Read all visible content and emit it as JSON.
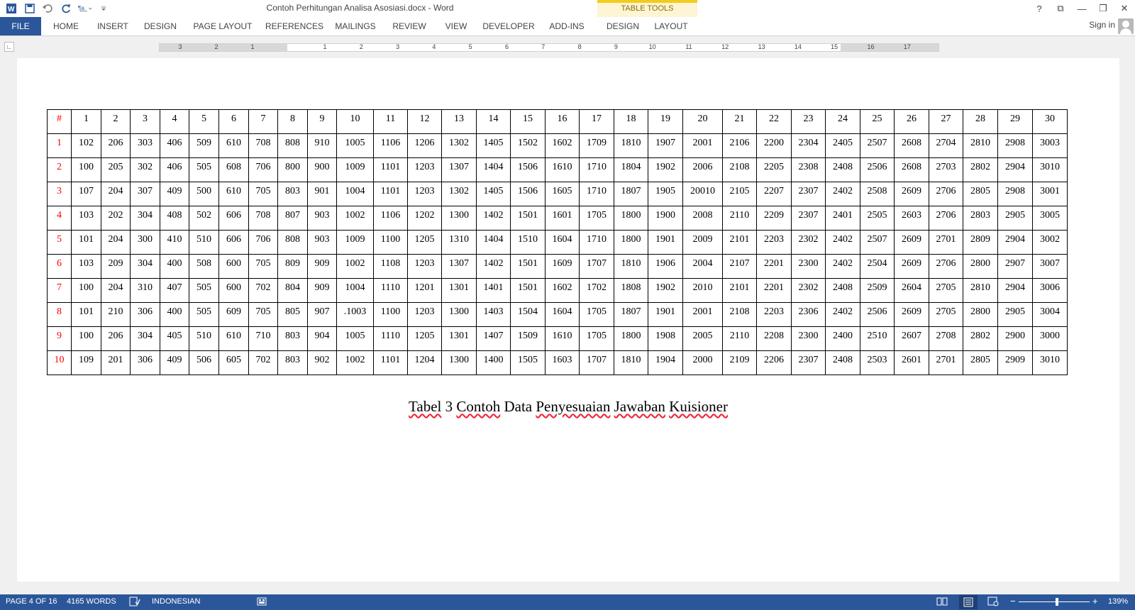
{
  "title_bar": {
    "document_title": "Contoh Perhitungan Analisa Asosiasi.docx - Word",
    "context_group": "TABLE TOOLS",
    "icons": [
      "word-app-icon",
      "save-icon",
      "undo-icon",
      "redo-icon",
      "format-icon",
      "customize-qat-icon"
    ],
    "window_buttons": [
      "?",
      "⧉",
      "—",
      "❐",
      "✕"
    ]
  },
  "ribbon": {
    "file_tab": "FILE",
    "tabs": [
      "HOME",
      "INSERT",
      "DESIGN",
      "PAGE LAYOUT",
      "REFERENCES",
      "MAILINGS",
      "REVIEW",
      "VIEW",
      "DEVELOPER",
      "ADD-INS"
    ],
    "context_tabs": [
      "DESIGN",
      "LAYOUT"
    ],
    "sign_in": "Sign in"
  },
  "ruler": {
    "left_numbers": [
      "3",
      "2",
      "1"
    ],
    "right_numbers": [
      "1",
      "2",
      "3",
      "4",
      "5",
      "6",
      "7",
      "8",
      "9",
      "10",
      "11",
      "12",
      "13",
      "14",
      "15",
      "16",
      "17"
    ]
  },
  "table": {
    "header": [
      "#",
      "1",
      "2",
      "3",
      "4",
      "5",
      "6",
      "7",
      "8",
      "9",
      "10",
      "11",
      "12",
      "13",
      "14",
      "15",
      "16",
      "17",
      "18",
      "19",
      "20",
      "21",
      "22",
      "23",
      "24",
      "25",
      "26",
      "27",
      "28",
      "29",
      "30"
    ],
    "rows": [
      [
        "1",
        "102",
        "206",
        "303",
        "406",
        "509",
        "610",
        "708",
        "808",
        "910",
        "1005",
        "1106",
        "1206",
        "1302",
        "1405",
        "1502",
        "1602",
        "1709",
        "1810",
        "1907",
        "2001",
        "2106",
        "2200",
        "2304",
        "2405",
        "2507",
        "2608",
        "2704",
        "2810",
        "2908",
        "3003"
      ],
      [
        "2",
        "100",
        "205",
        "302",
        "406",
        "505",
        "608",
        "706",
        "800",
        "900",
        "1009",
        "1101",
        "1203",
        "1307",
        "1404",
        "1506",
        "1610",
        "1710",
        "1804",
        "1902",
        "2006",
        "2108",
        "2205",
        "2308",
        "2408",
        "2506",
        "2608",
        "2703",
        "2802",
        "2904",
        "3010"
      ],
      [
        "3",
        "107",
        "204",
        "307",
        "409",
        "500",
        "610",
        "705",
        "803",
        "901",
        "1004",
        "1101",
        "1203",
        "1302",
        "1405",
        "1506",
        "1605",
        "1710",
        "1807",
        "1905",
        "20010",
        "2105",
        "2207",
        "2307",
        "2402",
        "2508",
        "2609",
        "2706",
        "2805",
        "2908",
        "3001"
      ],
      [
        "4",
        "103",
        "202",
        "304",
        "408",
        "502",
        "606",
        "708",
        "807",
        "903",
        "1002",
        "1106",
        "1202",
        "1300",
        "1402",
        "1501",
        "1601",
        "1705",
        "1800",
        "1900",
        "2008",
        "2110",
        "2209",
        "2307",
        "2401",
        "2505",
        "2603",
        "2706",
        "2803",
        "2905",
        "3005"
      ],
      [
        "5",
        "101",
        "204",
        "300",
        "410",
        "510",
        "606",
        "706",
        "808",
        "903",
        "1009",
        "1100",
        "1205",
        "1310",
        "1404",
        "1510",
        "1604",
        "1710",
        "1800",
        "1901",
        "2009",
        "2101",
        "2203",
        "2302",
        "2402",
        "2507",
        "2609",
        "2701",
        "2809",
        "2904",
        "3002"
      ],
      [
        "6",
        "103",
        "209",
        "304",
        "400",
        "508",
        "600",
        "705",
        "809",
        "909",
        "1002",
        "1108",
        "1203",
        "1307",
        "1402",
        "1501",
        "1609",
        "1707",
        "1810",
        "1906",
        "2004",
        "2107",
        "2201",
        "2300",
        "2402",
        "2504",
        "2609",
        "2706",
        "2800",
        "2907",
        "3007"
      ],
      [
        "7",
        "100",
        "204",
        "310",
        "407",
        "505",
        "600",
        "702",
        "804",
        "909",
        "1004",
        "1110",
        "1201",
        "1301",
        "1401",
        "1501",
        "1602",
        "1702",
        "1808",
        "1902",
        "2010",
        "2101",
        "2201",
        "2302",
        "2408",
        "2509",
        "2604",
        "2705",
        "2810",
        "2904",
        "3006"
      ],
      [
        "8",
        "101",
        "210",
        "306",
        "400",
        "505",
        "609",
        "705",
        "805",
        "907",
        ".1003",
        "1100",
        "1203",
        "1300",
        "1403",
        "1504",
        "1604",
        "1705",
        "1807",
        "1901",
        "2001",
        "2108",
        "2203",
        "2306",
        "2402",
        "2506",
        "2609",
        "2705",
        "2800",
        "2905",
        "3004"
      ],
      [
        "9",
        "100",
        "206",
        "304",
        "405",
        "510",
        "610",
        "710",
        "803",
        "904",
        "1005",
        "1110",
        "1205",
        "1301",
        "1407",
        "1509",
        "1610",
        "1705",
        "1800",
        "1908",
        "2005",
        "2110",
        "2208",
        "2300",
        "2400",
        "2510",
        "2607",
        "2708",
        "2802",
        "2900",
        "3000"
      ],
      [
        "10",
        "109",
        "201",
        "306",
        "409",
        "506",
        "605",
        "702",
        "803",
        "902",
        "1002",
        "1101",
        "1204",
        "1300",
        "1400",
        "1505",
        "1603",
        "1707",
        "1810",
        "1904",
        "2000",
        "2109",
        "2206",
        "2307",
        "2408",
        "2503",
        "2601",
        "2701",
        "2805",
        "2909",
        "3010"
      ]
    ]
  },
  "caption": {
    "parts": [
      "Tabel",
      " 3 ",
      "Contoh",
      " Data ",
      "Penyesuaian",
      " ",
      "Jawaban",
      " ",
      "Kuisioner"
    ]
  },
  "status_bar": {
    "page": "PAGE 4 OF 16",
    "words": "4165 WORDS",
    "language": "INDONESIAN",
    "zoom": "139%",
    "zoom_minus": "−",
    "zoom_plus": "+"
  }
}
